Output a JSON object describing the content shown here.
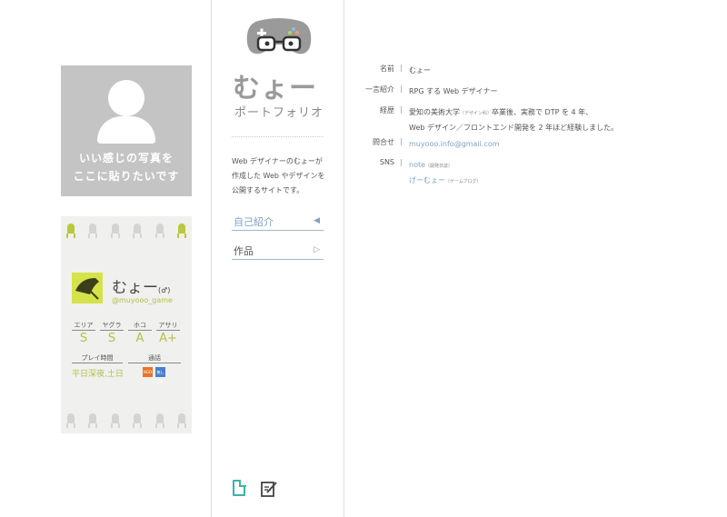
{
  "profile_photo": {
    "caption_lines": [
      "いい感じの写真を",
      "ここに貼りたいです"
    ]
  },
  "game_card": {
    "name": "むょー",
    "gender_mark": "(♂)",
    "handle": "@muyooo_game",
    "ranks": [
      {
        "mode": "エリア",
        "rank": "S"
      },
      {
        "mode": "ヤグラ",
        "rank": "S"
      },
      {
        "mode": "ホコ",
        "rank": "A"
      },
      {
        "mode": "アサリ",
        "rank": "A+"
      }
    ],
    "play_time_label": "プレイ時間",
    "play_time_value": "平日深夜,土日",
    "voice_chat_label": "通話",
    "voice_badges": [
      "NGO",
      "無し\nOK"
    ],
    "colors": {
      "accent_green": "#b3c048",
      "squid_gray": "#d4d4d4"
    }
  },
  "sidebar": {
    "logo_text": "むょー",
    "logo_sub": "ポートフォリオ",
    "intro_lines": [
      "Web デザイナーのむょーが",
      "作成した Web やデザインを",
      "公開するサイトです。"
    ],
    "nav": [
      {
        "label": "自己紹介",
        "arrow": "◀"
      },
      {
        "label": "作品",
        "arrow": "▷"
      }
    ],
    "footer_icons": [
      "note-icon",
      "edit-icon"
    ],
    "accent_color": "#7fa3c5"
  },
  "profile": {
    "rows": [
      {
        "label": "名前",
        "sep": "|",
        "lines": [
          "むょー"
        ]
      },
      {
        "label": "一言紹介",
        "sep": "|",
        "lines": [
          "RPG する Web デザイナー"
        ]
      },
      {
        "label": "経歴",
        "sep": "|",
        "lines": [
          "愛知の美術大学",
          "卒業後、実務で DTP を 4 年、",
          "Web デザイン／フロントエンド開発を 2 年ほど経験しました。"
        ],
        "small_note": "（デザイン科）"
      },
      {
        "label": "問合せ",
        "sep": "|",
        "lines": [
          "muyooo.info@gmail.com"
        ]
      },
      {
        "label": "SNS",
        "sep": "|",
        "lines": [
          "note",
          "げーむょー"
        ],
        "small_notes": [
          "（開発日誌）",
          "（ゲームブログ）"
        ]
      }
    ]
  }
}
